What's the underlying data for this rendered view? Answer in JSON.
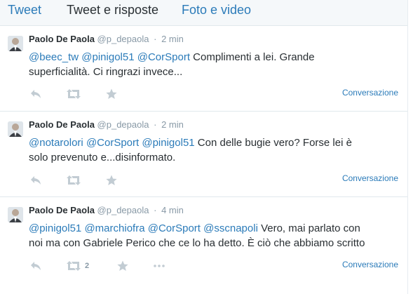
{
  "tabs": [
    {
      "label": "Tweet"
    },
    {
      "label": "Tweet e risposte"
    },
    {
      "label": "Foto e video"
    }
  ],
  "colors": {
    "link": "#2b7bb9",
    "text": "#292f33",
    "muted": "#8899a6",
    "icon": "#c2ccd3"
  },
  "tweets": [
    {
      "name": "Paolo De Paola",
      "handle": "@p_depaola",
      "separator": "·",
      "time": "2 min",
      "line1": [
        {
          "text": "@beec_tw",
          "mention": true
        },
        {
          "text": " ",
          "mention": false
        },
        {
          "text": "@pinigol51",
          "mention": true
        },
        {
          "text": " ",
          "mention": false
        },
        {
          "text": "@CorSport",
          "mention": true
        },
        {
          "text": " Complimenti a lei. Grande",
          "mention": false
        }
      ],
      "line2": "superficialità.  Ci ringrazi invece...",
      "retweet_count": "",
      "conversation_label": "Conversazione",
      "icons": [
        "reply-icon",
        "retweet-icon",
        "favorite-star-icon",
        "more-dots-icon"
      ]
    },
    {
      "name": "Paolo De Paola",
      "handle": "@p_depaola",
      "separator": "·",
      "time": "2 min",
      "line1": [
        {
          "text": "@notarolori",
          "mention": true
        },
        {
          "text": " ",
          "mention": false
        },
        {
          "text": "@CorSport",
          "mention": true
        },
        {
          "text": " ",
          "mention": false
        },
        {
          "text": "@pinigol51",
          "mention": true
        },
        {
          "text": " Con delle bugie vero? Forse lei è",
          "mention": false
        }
      ],
      "line2": "solo prevenuto e...disinformato.",
      "retweet_count": "",
      "conversation_label": "Conversazione",
      "icons": [
        "reply-icon",
        "retweet-icon",
        "favorite-star-icon",
        "more-dots-icon"
      ]
    },
    {
      "name": "Paolo De Paola",
      "handle": "@p_depaola",
      "separator": "·",
      "time": "4 min",
      "line1": [
        {
          "text": "@pinigol51",
          "mention": true
        },
        {
          "text": " ",
          "mention": false
        },
        {
          "text": "@marchiofra",
          "mention": true
        },
        {
          "text": " ",
          "mention": false
        },
        {
          "text": "@CorSport",
          "mention": true
        },
        {
          "text": " ",
          "mention": false
        },
        {
          "text": "@sscnapoli",
          "mention": true
        },
        {
          "text": " Vero, mai parlato con",
          "mention": false
        }
      ],
      "line2": "noi ma con Gabriele Perico che ce lo ha detto. È ciò che abbiamo scritto",
      "retweet_count": "2",
      "conversation_label": "Conversazione",
      "icons": [
        "reply-icon",
        "retweet-icon",
        "favorite-star-icon",
        "more-dots-icon"
      ]
    }
  ]
}
